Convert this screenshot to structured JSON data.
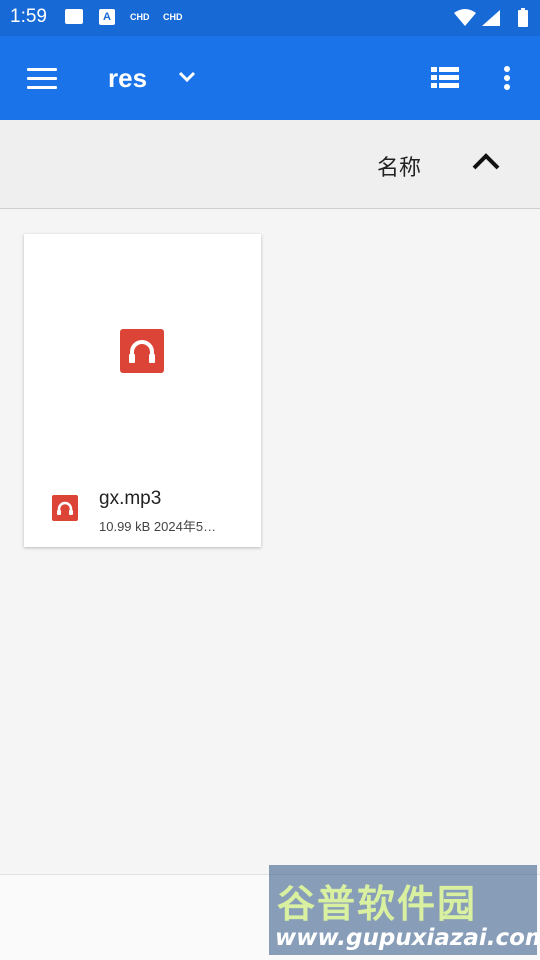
{
  "status_bar": {
    "time": "1:59",
    "icons": [
      "image-icon",
      "a-icon",
      "chd-icon",
      "chd-icon",
      "wifi-icon",
      "signal-icon",
      "battery-icon"
    ],
    "chd_label_1": "CHD",
    "chd_label_2": "CHD",
    "a_label": "A"
  },
  "app_bar": {
    "title": "res",
    "background": "#1a73e8"
  },
  "sort_bar": {
    "label": "名称",
    "direction": "ascending"
  },
  "files": [
    {
      "name": "gx.mp3",
      "meta": "10.99 kB  2024年5…",
      "icon": "audio-file-icon",
      "icon_color": "#db4437"
    }
  ],
  "watermark": {
    "title": "谷普软件园",
    "url": "www.gupuxiazai.com"
  }
}
